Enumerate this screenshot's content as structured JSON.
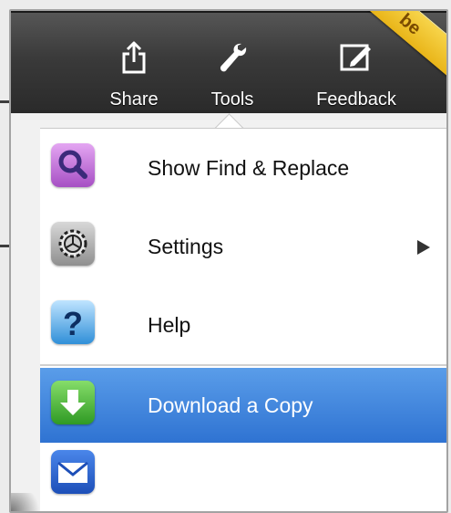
{
  "toolbar": {
    "share_label": "Share",
    "tools_label": "Tools",
    "feedback_label": "Feedback",
    "badge_text": "be",
    "share_icon": "share-icon",
    "tools_icon": "wrench-icon",
    "feedback_icon": "pencil-note-icon"
  },
  "menu": {
    "items": [
      {
        "label": "Show Find & Replace",
        "icon": "magnifier-icon"
      },
      {
        "label": "Settings",
        "icon": "gear-icon",
        "has_submenu": true
      },
      {
        "label": "Help",
        "icon": "question-icon"
      },
      {
        "label": "Download a Copy",
        "icon": "download-arrow-icon",
        "highlighted": true
      },
      {
        "label": "",
        "icon": "envelope-icon"
      }
    ]
  },
  "colors": {
    "toolbar_bg": "#3a3a3a",
    "highlight": "#3f86df",
    "badge": "#f2c93a"
  }
}
